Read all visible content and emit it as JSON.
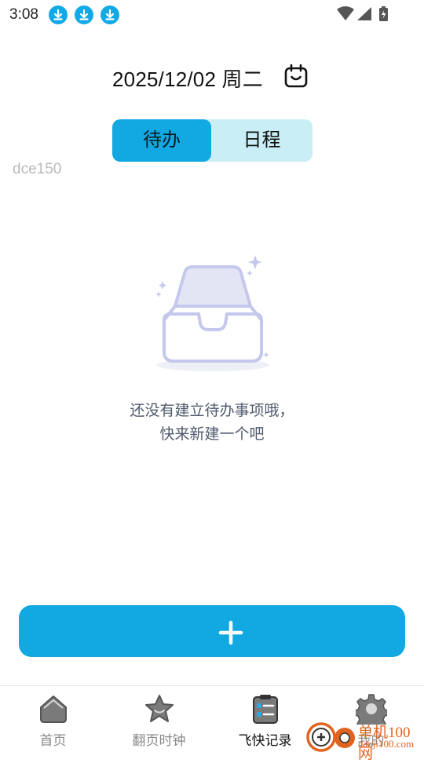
{
  "status_bar": {
    "time": "3:08",
    "notification_icons": [
      "download-icon",
      "download-icon",
      "download-icon"
    ],
    "system_icons": [
      "wifi-icon",
      "cellular-signal-icon",
      "battery-icon"
    ]
  },
  "header": {
    "date_label": "2025/12/02 周二",
    "calendar_icon": "calendar-icon"
  },
  "segmented_control": {
    "tabs": [
      {
        "label": "待办",
        "active": true
      },
      {
        "label": "日程",
        "active": false
      }
    ]
  },
  "device_id": "dce150",
  "empty_state": {
    "icon": "empty-inbox-icon",
    "line1": "还没有建立待办事项哦，",
    "line2": "快来新建一个吧"
  },
  "add_button": {
    "icon": "plus-icon"
  },
  "bottom_nav": {
    "items": [
      {
        "label": "首页",
        "icon": "home-icon",
        "active": false
      },
      {
        "label": "翻页时钟",
        "icon": "star-icon",
        "active": false
      },
      {
        "label": "飞快记录",
        "icon": "clipboard-list-icon",
        "active": true
      },
      {
        "label": "我的",
        "icon": "gear-icon",
        "active": false
      }
    ]
  },
  "watermark": {
    "brand": "单机100网",
    "url": "danji100.com"
  },
  "colors": {
    "accent": "#12a8e2",
    "segment_bg": "#c9eef6",
    "empty_text": "#4f5a6b",
    "watermark": "#e0641f"
  }
}
